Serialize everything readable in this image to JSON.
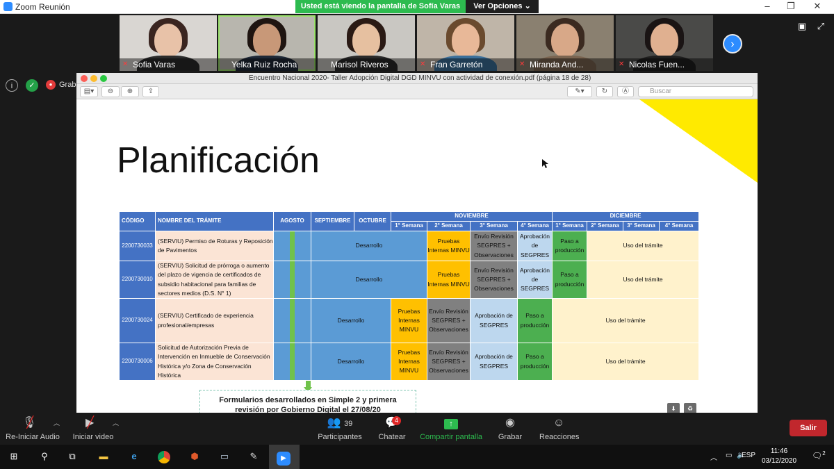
{
  "window": {
    "title": "Zoom Reunión",
    "controls": [
      "–",
      "❐",
      "✕"
    ]
  },
  "share_banner": {
    "message": "Usted está viendo la pantalla de Sofía Varas",
    "options_label": "Ver Opciones ⌄"
  },
  "participants": [
    {
      "name": "Sofia Varas",
      "skin": "#e8c2a8",
      "hair": "#3a2520",
      "shirt": "#2b2b2b",
      "bg": "#d9d6d2",
      "muted": true
    },
    {
      "name": "Yelka Ruiz Rocha",
      "skin": "#c89878",
      "hair": "#1e1410",
      "shirt": "#1f2937",
      "bg": "#b8b6ae",
      "muted": false
    },
    {
      "name": "Marisol Riveros",
      "skin": "#e6c0a0",
      "hair": "#2a1a14",
      "shirt": "#2a2a2a",
      "bg": "#c9c7c2",
      "muted": false
    },
    {
      "name": "Fran Garretón",
      "skin": "#e8b898",
      "hair": "#6a4a2e",
      "shirt": "#3b6f9a",
      "bg": "#bfb5a8",
      "muted": true
    },
    {
      "name": "Miranda And...",
      "skin": "#d8a888",
      "hair": "#3b2a20",
      "shirt": "#7a6450",
      "bg": "#8a8070",
      "muted": true
    },
    {
      "name": "Nicolas Fuen...",
      "skin": "#e0b090",
      "hair": "#1a1414",
      "shirt": "#1f1f1f",
      "bg": "#4a4a48",
      "muted": true
    }
  ],
  "left_indicators": {
    "record_label": "Graba"
  },
  "pdf": {
    "title": "Encuentro Nacional 2020- Taller Adopción Digital DGD MINVU con actividad de conexión.pdf (página 18 de 28)",
    "search_placeholder": "Buscar"
  },
  "slide": {
    "title": "Planificación",
    "note_line1": "Formularios desarrollados en Simple 2 y primera",
    "note_line2": "revisión por Gobierno Digital el 27/08/20"
  },
  "table": {
    "header1": {
      "codigo": "CÓDIGO",
      "nombre": "NOMBRE DEL TRÁMITE",
      "agosto": "AGOSTO",
      "septiembre": "SEPTIEMBRE",
      "octubre": "OCTUBRE",
      "noviembre": "NOVIEMBRE",
      "diciembre": "DICIEMBRE"
    },
    "weeks": [
      "1° Semana",
      "2° Semana",
      "3° Semana",
      "4° Semana",
      "1° Semana",
      "2° Semana",
      "3° Semana",
      "4° Semana"
    ],
    "rows": [
      {
        "code": "2200730033",
        "name": "(SERVIU) Permiso de Roturas y Reposición de Pavimentos",
        "desarrollo": "Desarrollo",
        "pruebas": "Pruebas Internas MINVU",
        "envio": "Envío Revisión SEGPRES + Observaciones",
        "aprobacion": "Aprobación de SEGPRES",
        "paso": "Paso a producción",
        "uso": "Uso del trámite"
      },
      {
        "code": "2200730010",
        "name": "(SERVIU) Solicitud de prórroga o aumento del plazo de vigencia de certificados de subsidio habitacional para familias de sectores medios (D.S. N° 1)",
        "desarrollo": "Desarrollo",
        "pruebas": "Pruebas Internas MINVU",
        "envio": "Envío Revisión SEGPRES + Observaciones",
        "aprobacion": "Aprobación de SEGPRES",
        "paso": "Paso a producción",
        "uso": "Uso del trámite"
      },
      {
        "code": "2200730024",
        "name": "(SERVIU) Certificado de experiencia profesional/empresas",
        "desarrollo": "Desarrollo",
        "pruebas": "Pruebas Internas MINVU",
        "envio": "Envío Revisión SEGPRES + Observaciones",
        "aprobacion": "Aprobación de SEGPRES",
        "paso": "Paso a producción",
        "uso": "Uso del trámite"
      },
      {
        "code": "2200730006",
        "name": "Solicitud de Autorización Previa de Intervención en Inmueble de Conservación Histórica y/o Zona de Conservación Histórica",
        "desarrollo": "Desarrollo",
        "pruebas": "Pruebas Internas MINVU",
        "envio": "Envío Revisión SEGPRES + Observaciones",
        "aprobacion": "Aprobación de SEGPRES",
        "paso": "Paso a producción",
        "uso": "Uso del trámite"
      }
    ]
  },
  "toolbar": {
    "audio_label": "Re-Iniciar Audio",
    "video_label": "Iniciar video",
    "participants_label": "Participantes",
    "participants_count": "39",
    "chat_label": "Chatear",
    "chat_badge": "4",
    "share_label": "Compartir pantalla",
    "record_label": "Grabar",
    "reactions_label": "Reacciones",
    "leave_label": "Salir"
  },
  "taskbar": {
    "lang": "ESP",
    "time": "11:46",
    "date": "03/12/2020",
    "notif_count": "2"
  },
  "colors": {
    "zoom_blue": "#2d8cff",
    "share_green": "#2dbb4f",
    "leave_red": "#c1272d",
    "table_header": "#4472c4"
  }
}
